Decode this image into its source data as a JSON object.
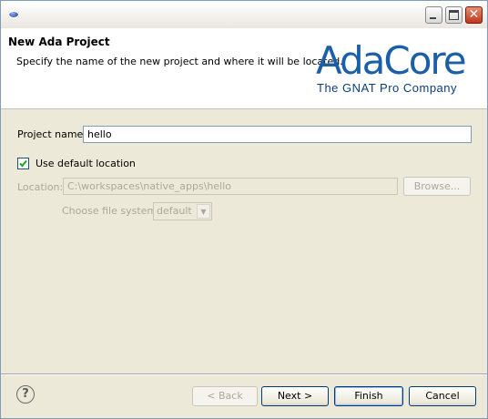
{
  "window": {
    "title": ""
  },
  "header": {
    "title": "New Ada Project",
    "description": "Specify the name of the new project and where it will be located.",
    "logo": {
      "word": "AdaCore",
      "tagline": "The GNAT Pro Company"
    }
  },
  "form": {
    "project_name_label": "Project name:",
    "project_name_value": "hello",
    "use_default_location_label": "Use default location",
    "use_default_location_checked": true,
    "location_label": "Location:",
    "location_value": "C:\\workspaces\\native_apps\\hello",
    "browse_label": "Browse...",
    "file_system_label": "Choose file system:",
    "file_system_value": "default"
  },
  "footer": {
    "back_label": "< Back",
    "next_label": "Next >",
    "finish_label": "Finish",
    "cancel_label": "Cancel"
  },
  "colors": {
    "accent": "#1a5fa8",
    "disabled_text": "#aca899"
  }
}
